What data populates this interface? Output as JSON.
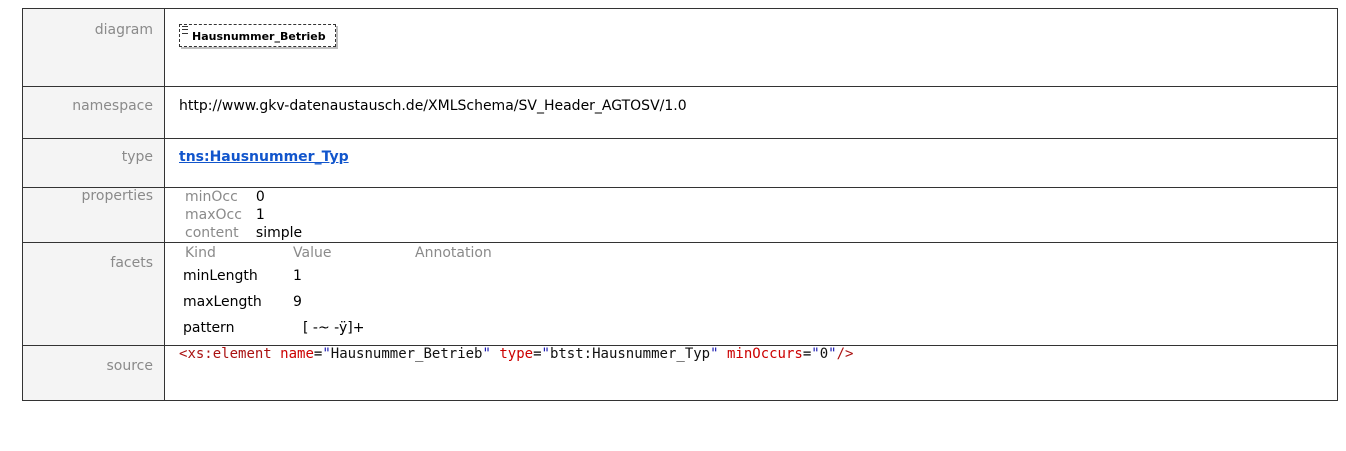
{
  "diagram": {
    "label": "diagram",
    "element_name": "Hausnummer_Betrieb",
    "element_icon": "element-icon"
  },
  "namespace": {
    "label": "namespace",
    "value": "http://www.gkv-datenaustausch.de/XMLSchema/SV_Header_AGTOSV/1.0"
  },
  "type": {
    "label": "type",
    "value": "tns:Hausnummer_Typ"
  },
  "properties": {
    "label": "properties",
    "items": [
      {
        "key": "minOcc",
        "value": "0"
      },
      {
        "key": "maxOcc",
        "value": "1"
      },
      {
        "key": "content",
        "value": "simple"
      }
    ]
  },
  "facets": {
    "label": "facets",
    "headers": [
      "Kind",
      "Value",
      "Annotation"
    ],
    "rows": [
      {
        "kind": "minLength",
        "value": "1",
        "annotation": ""
      },
      {
        "kind": "maxLength",
        "value": "9",
        "annotation": ""
      },
      {
        "kind": "pattern",
        "value": "[ -~ -ÿ]+",
        "annotation": ""
      }
    ]
  },
  "source": {
    "label": "source",
    "open": "<",
    "tag": "xs:element",
    "attrs": [
      {
        "name": "name",
        "value": "Hausnummer_Betrieb"
      },
      {
        "name": "type",
        "value": "btst:Hausnummer_Typ"
      },
      {
        "name": "minOccurs",
        "value": "0"
      }
    ],
    "close": "/>"
  },
  "colors": {
    "label_text": "#8a8a8a",
    "link": "#1155cc",
    "xml_tag": "#aa1111",
    "xml_attr": "#cc0000",
    "xml_string": "#1a1ab0"
  }
}
